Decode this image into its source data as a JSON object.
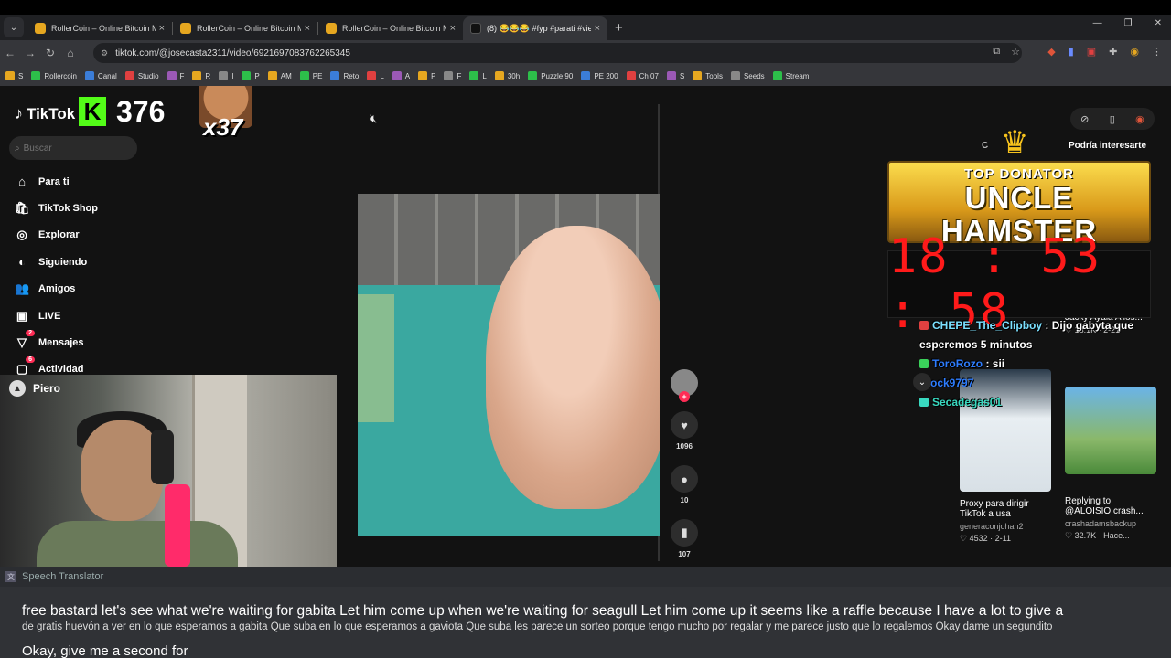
{
  "browser": {
    "tabs": [
      {
        "title": "RollerCoin – Online Bitcoin Min",
        "active": false
      },
      {
        "title": "RollerCoin – Online Bitcoin Min",
        "active": false
      },
      {
        "title": "RollerCoin – Online Bitcoin Min",
        "active": false
      },
      {
        "title": "(8) 😂😂😂 #fyp #parati #viejo",
        "active": true
      }
    ],
    "url": "tiktok.com/@josecasta2311/video/6921697083762265345",
    "bookmarks": [
      "S",
      "Rollercoin",
      "Canal",
      "Studio",
      "F",
      "R",
      "I",
      "P",
      "AM",
      "PE",
      "Reto",
      "L",
      "A",
      "P",
      "F",
      "L",
      "30h",
      "Puzzle 90",
      "PE 200",
      "Ch 07",
      "S",
      "Tools",
      "Seeds",
      "Stream"
    ]
  },
  "overlay": {
    "kick_count": "376",
    "emote_multiplier": "x37",
    "webcam_user": "Piero"
  },
  "tiktok": {
    "logo": "TikTok",
    "search_placeholder": "Buscar",
    "nav": [
      {
        "label": "Para ti",
        "icon": "home-icon",
        "badge": ""
      },
      {
        "label": "TikTok Shop",
        "icon": "shop-icon",
        "badge": ""
      },
      {
        "label": "Explorar",
        "icon": "compass-icon",
        "badge": ""
      },
      {
        "label": "Siguiendo",
        "icon": "following-icon",
        "badge": ""
      },
      {
        "label": "Amigos",
        "icon": "friends-icon",
        "badge": ""
      },
      {
        "label": "LIVE",
        "icon": "live-icon",
        "badge": ""
      },
      {
        "label": "Mensajes",
        "icon": "messages-icon",
        "badge": "2"
      },
      {
        "label": "Actividad",
        "icon": "activity-icon",
        "badge": "6"
      }
    ],
    "actions": {
      "likes": "1096",
      "comments": "10",
      "saves": "107"
    },
    "right_tabs": {
      "c": "C",
      "related": "Podría interesarte"
    }
  },
  "donator": {
    "label": "TOP DONATOR",
    "name": "UNCLE HAMSTER"
  },
  "timer": "18 : 53 : 58",
  "cards": [
    {
      "title": "Jacky Ayala A los...",
      "stats": "13.1K · 2-21"
    },
    {
      "title": "Proxy para dirigir TikTok a usa",
      "sub": "generaconjohan2",
      "stats": "4532 · 2-11"
    },
    {
      "title": "Replying to @ALOISIO crash...",
      "sub": "crashadamsbackup",
      "stats": "32.7K · Hace..."
    }
  ],
  "chat": [
    {
      "name": "CHEPE_The_Clipboy",
      "message": ": Dijo gabyta que esperemos 5 minutos"
    },
    {
      "name": "ToroRozo",
      "message": ": sii"
    },
    {
      "name": "Stock9797",
      "message": ""
    },
    {
      "name": "Secadegas01",
      "message": ""
    }
  ],
  "translator": {
    "title": "Speech Translator",
    "english": "free bastard let's see what we're waiting for gabita Let him come up when we're waiting for seagull Let him come up it seems like a raffle because I have a lot to give a",
    "spanish": "de gratis huevón a ver en lo que esperamos a gabita Que suba en lo que esperamos a gaviota Que suba les parece un sorteo porque tengo mucho por regalar y me parece justo que lo regalemos Okay dame un segundito",
    "next": "Okay, give me a second for"
  }
}
